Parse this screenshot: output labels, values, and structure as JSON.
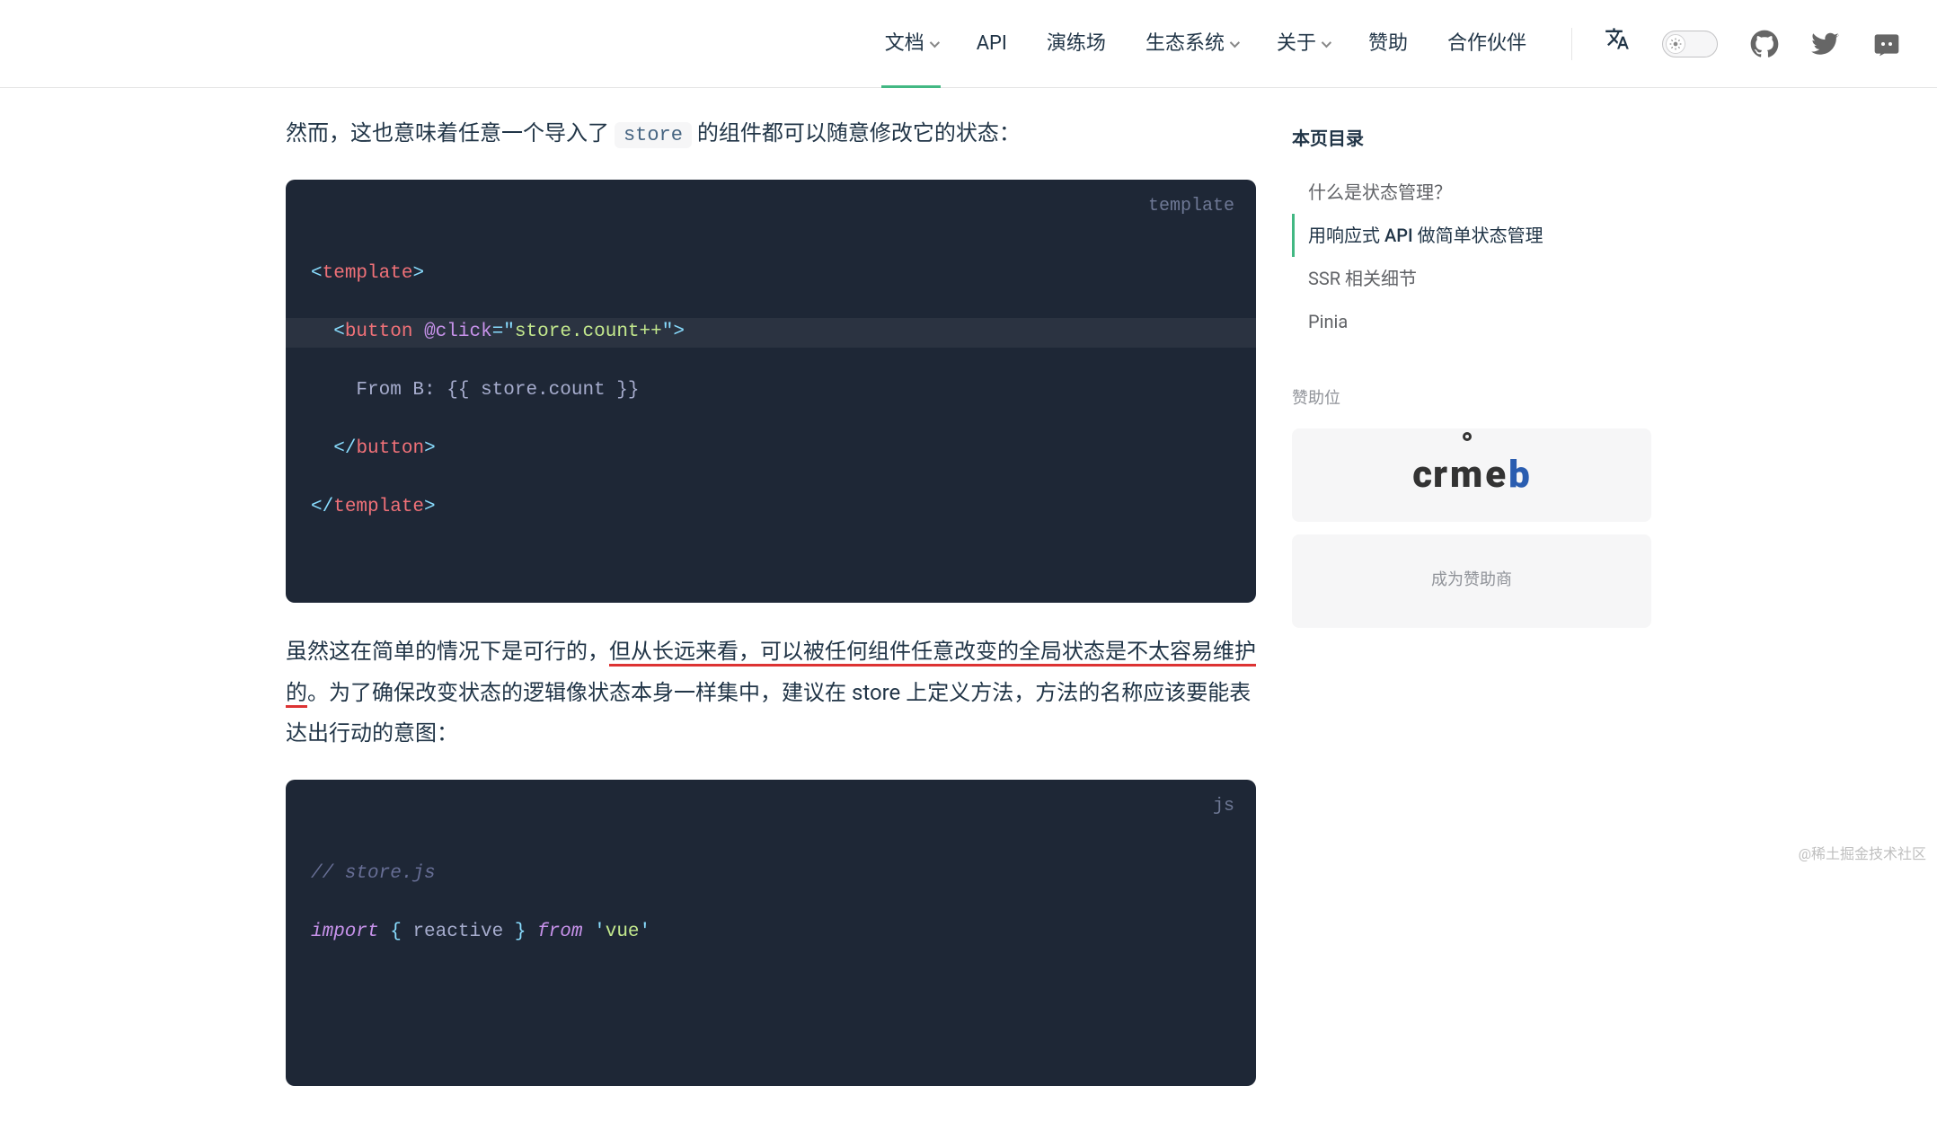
{
  "nav": {
    "items": [
      {
        "label": "文档",
        "dropdown": true,
        "active": true
      },
      {
        "label": "API",
        "dropdown": false
      },
      {
        "label": "演练场",
        "dropdown": false
      },
      {
        "label": "生态系统",
        "dropdown": true
      },
      {
        "label": "关于",
        "dropdown": true
      },
      {
        "label": "赞助",
        "dropdown": false
      },
      {
        "label": "合作伙伴",
        "dropdown": false
      }
    ]
  },
  "paragraph1": {
    "pre": "然而，这也意味着任意一个导入了 ",
    "code": "store",
    "post": " 的组件都可以随意修改它的状态："
  },
  "code1": {
    "lang": "template",
    "l1_open": "<",
    "l1_tag": "template",
    "l1_close": ">",
    "l2_open": "<",
    "l2_tag": "button",
    "l2_sp": " ",
    "l2_attr": "@click",
    "l2_eq": "=",
    "l2_q1": "\"",
    "l2_str": "store.count++",
    "l2_q2": "\"",
    "l2_close": ">",
    "l3": "    From B: {{ store.count }}",
    "l4_open": "</",
    "l4_tag": "button",
    "l4_close": ">",
    "l5_open": "</",
    "l5_tag": "template",
    "l5_close": ">"
  },
  "paragraph2": {
    "seg1": "虽然这在简单的情况下是可行的，",
    "red1": "但从长远来看，可以被任何组件任意改变的全局状态是不太容",
    "red2": "易维护的",
    "seg2": "。为了确保改变状态的逻辑像状态本身一样集中，建议在 store 上定义方法，方法的名称应该要能表达出行动的意图："
  },
  "code2": {
    "lang": "js",
    "l1": "// store.js",
    "l2_import": "import",
    "l2_brace_open": " { ",
    "l2_reactive": "reactive",
    "l2_brace_close": " } ",
    "l2_from": "from",
    "l2_sp": " ",
    "l2_q1": "'",
    "l2_vue": "vue",
    "l2_q2": "'"
  },
  "toc": {
    "title": "本页目录",
    "items": [
      {
        "label": "什么是状态管理？",
        "active": false
      },
      {
        "label": "用响应式 API 做简单状态管理",
        "active": true
      },
      {
        "label": "SSR 相关细节",
        "active": false
      },
      {
        "label": "Pinia",
        "active": false
      }
    ]
  },
  "sponsor": {
    "label": "赞助位",
    "logo": "crmeb",
    "become": "成为赞助商"
  },
  "watermark": "@稀土掘金技术社区"
}
